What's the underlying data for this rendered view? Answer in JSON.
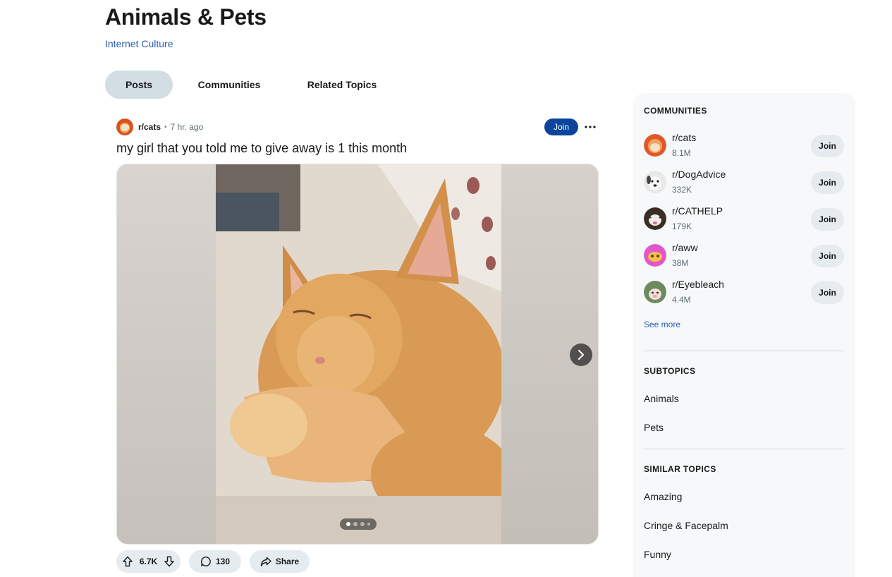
{
  "header": {
    "title": "Animals & Pets",
    "breadcrumb": "Internet Culture"
  },
  "tabs": [
    {
      "label": "Posts",
      "active": true
    },
    {
      "label": "Communities",
      "active": false
    },
    {
      "label": "Related Topics",
      "active": false
    }
  ],
  "post": {
    "subreddit": "r/cats",
    "separator": "•",
    "time": "7 hr. ago",
    "join_label": "Join",
    "title": "my girl that you told me to give away is 1 this month",
    "image_count": 4,
    "image_index": 1,
    "votes": "6.7K",
    "comments": "130",
    "share_label": "Share"
  },
  "sidebar": {
    "communities_heading": "COMMUNITIES",
    "communities": [
      {
        "name": "r/cats",
        "members": "8.1M",
        "join": "Join"
      },
      {
        "name": "r/DogAdvice",
        "members": "332K",
        "join": "Join"
      },
      {
        "name": "r/CATHELP",
        "members": "179K",
        "join": "Join"
      },
      {
        "name": "r/aww",
        "members": "38M",
        "join": "Join"
      },
      {
        "name": "r/Eyebleach",
        "members": "4.4M",
        "join": "Join"
      }
    ],
    "see_more": "See more",
    "subtopics_heading": "SUBTOPICS",
    "subtopics": [
      "Animals",
      "Pets"
    ],
    "similar_heading": "SIMILAR TOPICS",
    "similar": [
      "Amazing",
      "Cringe & Facepalm",
      "Funny"
    ]
  },
  "colors": {
    "accent": "#0a449b",
    "link": "#2a5db0",
    "active_tab": "#d2dde4",
    "pill": "#e5ebee"
  }
}
